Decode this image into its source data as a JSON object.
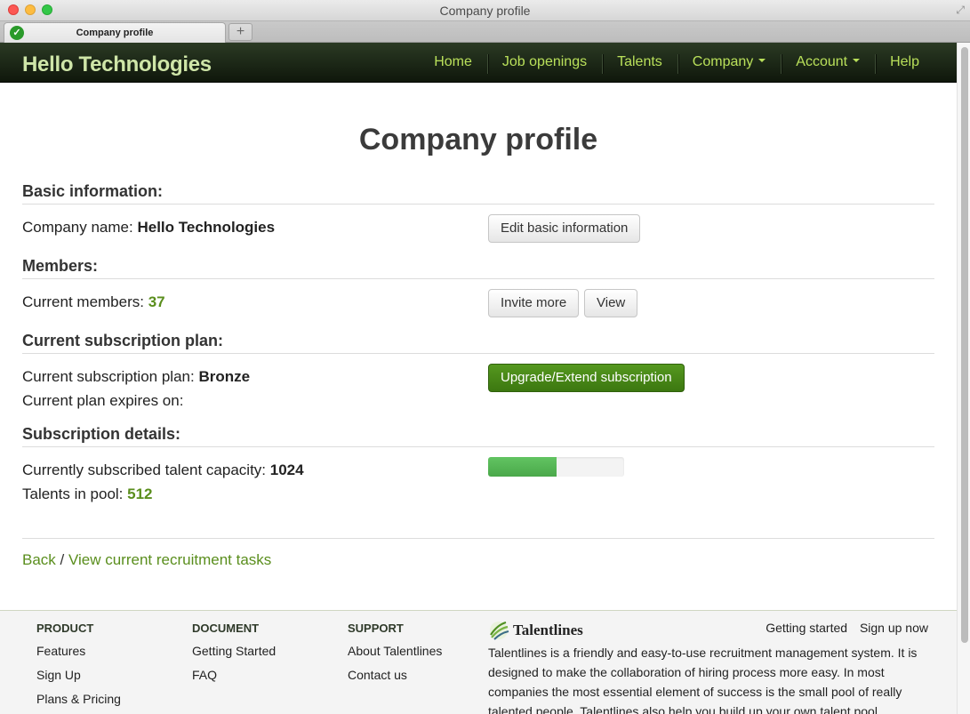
{
  "window": {
    "title": "Company profile",
    "tab_title": "Company profile",
    "new_tab_label": "+"
  },
  "navbar": {
    "brand": "Hello Technologies",
    "items": [
      {
        "label": "Home",
        "has_caret": false
      },
      {
        "label": "Job openings",
        "has_caret": false
      },
      {
        "label": "Talents",
        "has_caret": false
      },
      {
        "label": "Company",
        "has_caret": true
      },
      {
        "label": "Account",
        "has_caret": true
      },
      {
        "label": "Help",
        "has_caret": false
      }
    ]
  },
  "page": {
    "title": "Company profile",
    "basic": {
      "heading": "Basic information:",
      "company_label": "Company name:",
      "company_value": "Hello Technologies",
      "edit_button": "Edit basic information"
    },
    "members": {
      "heading": "Members:",
      "current_label": "Current members:",
      "current_value": "37",
      "invite_button": "Invite more",
      "view_button": "View"
    },
    "plan": {
      "heading": "Current subscription plan:",
      "plan_label": "Current subscription plan:",
      "plan_value": "Bronze",
      "expires_label": "Current plan expires on:",
      "upgrade_button": "Upgrade/Extend subscription"
    },
    "details": {
      "heading": "Subscription details:",
      "capacity_label": "Currently subscribed talent capacity:",
      "capacity_value": "1024",
      "pool_label": "Talents in pool:",
      "pool_value": "512",
      "usage_fraction": 0.5
    },
    "links": {
      "back": "Back",
      "separator": " / ",
      "tasks": "View current recruitment tasks"
    }
  },
  "footer": {
    "product": {
      "heading": "PRODUCT",
      "items": [
        "Features",
        "Sign Up",
        "Plans & Pricing"
      ]
    },
    "document": {
      "heading": "DOCUMENT",
      "items": [
        "Getting Started",
        "FAQ"
      ]
    },
    "support": {
      "heading": "SUPPORT",
      "items": [
        "About Talentlines",
        "Contact us"
      ]
    },
    "brand": "Talentlines",
    "top_links": [
      "Getting started",
      "Sign up now"
    ],
    "description": "Talentlines is a friendly and easy-to-use recruitment management system. It is designed to make the collaboration of hiring process more easy. In most companies the most essential element of success is the small pool of really talented people. Talentlines also help you build up your own talent pool"
  },
  "colors": {
    "accent_green": "#5a8e1d",
    "nav_link": "#b9e05a",
    "navbar_bg": "#1a2613",
    "success_button": "#4a8a18"
  }
}
